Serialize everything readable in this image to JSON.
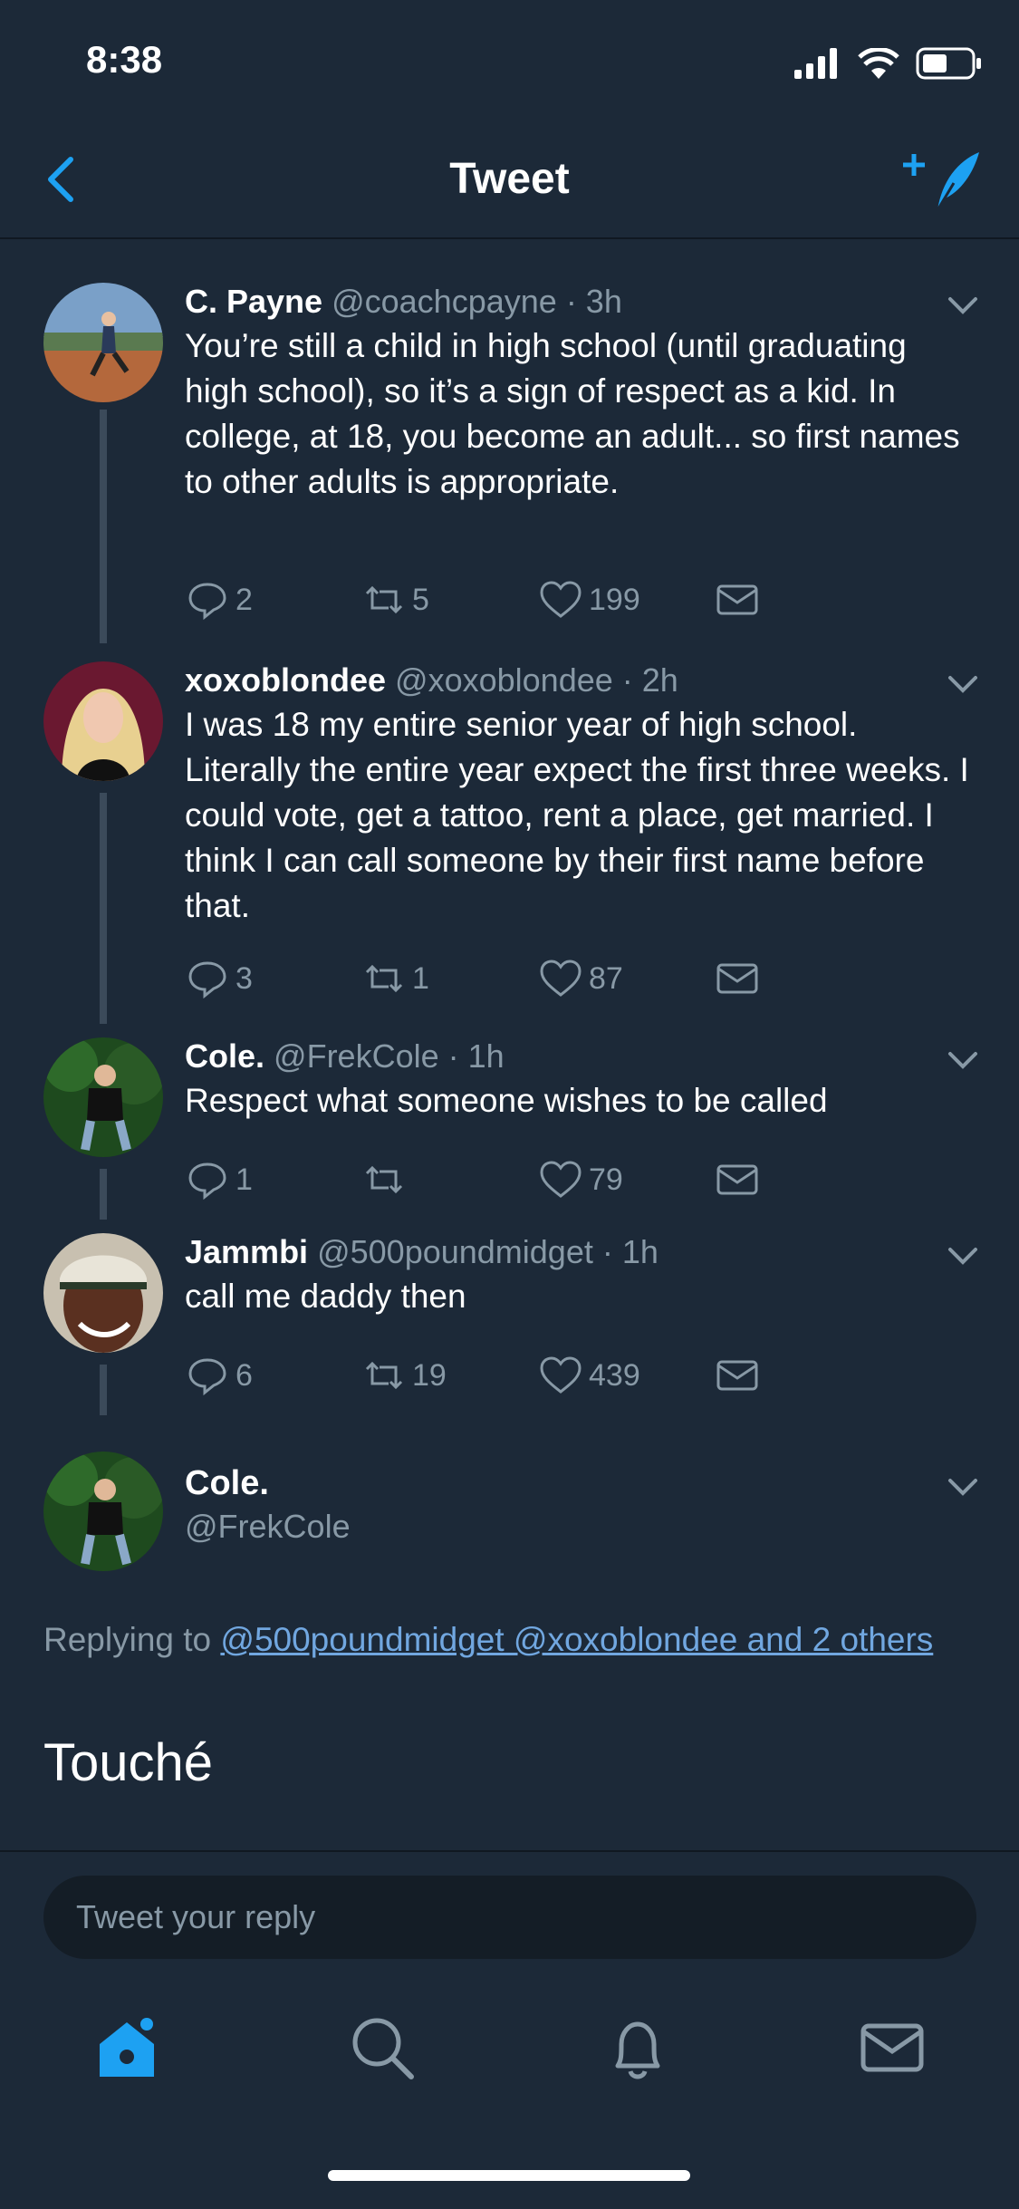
{
  "status": {
    "time": "8:38"
  },
  "nav": {
    "title": "Tweet"
  },
  "tweets": [
    {
      "name": "C. Payne",
      "handle": "@coachcpayne",
      "time": "· 3h",
      "text": "You’re still a child in high school (until graduating high school), so it’s a sign of respect as a kid. In college, at 18, you become an adult... so first names to other adults is appropriate.",
      "replies": "2",
      "retweets": "5",
      "likes": "199"
    },
    {
      "name": "xoxoblondee",
      "handle": "@xoxoblondee",
      "time": "· 2h",
      "text": "I was 18 my entire senior year of high school. Literally the entire year expect the first three weeks. I could vote, get a tattoo, rent a place, get married. I think I can call someone by their first name before that.",
      "replies": "3",
      "retweets": "1",
      "likes": "87"
    },
    {
      "name": "Cole.",
      "handle": "@FrekCole",
      "time": "· 1h",
      "text": "Respect what someone wishes to be called",
      "replies": "1",
      "retweets": "",
      "likes": "79"
    },
    {
      "name": "Jammbi",
      "handle": "@500poundmidget",
      "time": "· 1h",
      "text": "call me daddy then",
      "replies": "6",
      "retweets": "19",
      "likes": "439"
    }
  ],
  "detail": {
    "name": "Cole.",
    "handle": "@FrekCole",
    "replying_prefix": "Replying to ",
    "replying_links": "@500poundmidget @xoxoblondee and 2 others",
    "text": "Touché"
  },
  "composer": {
    "placeholder": "Tweet your reply"
  },
  "colors": {
    "background": "#1c2938",
    "accent": "#1da1f2",
    "muted": "#8899a6"
  }
}
